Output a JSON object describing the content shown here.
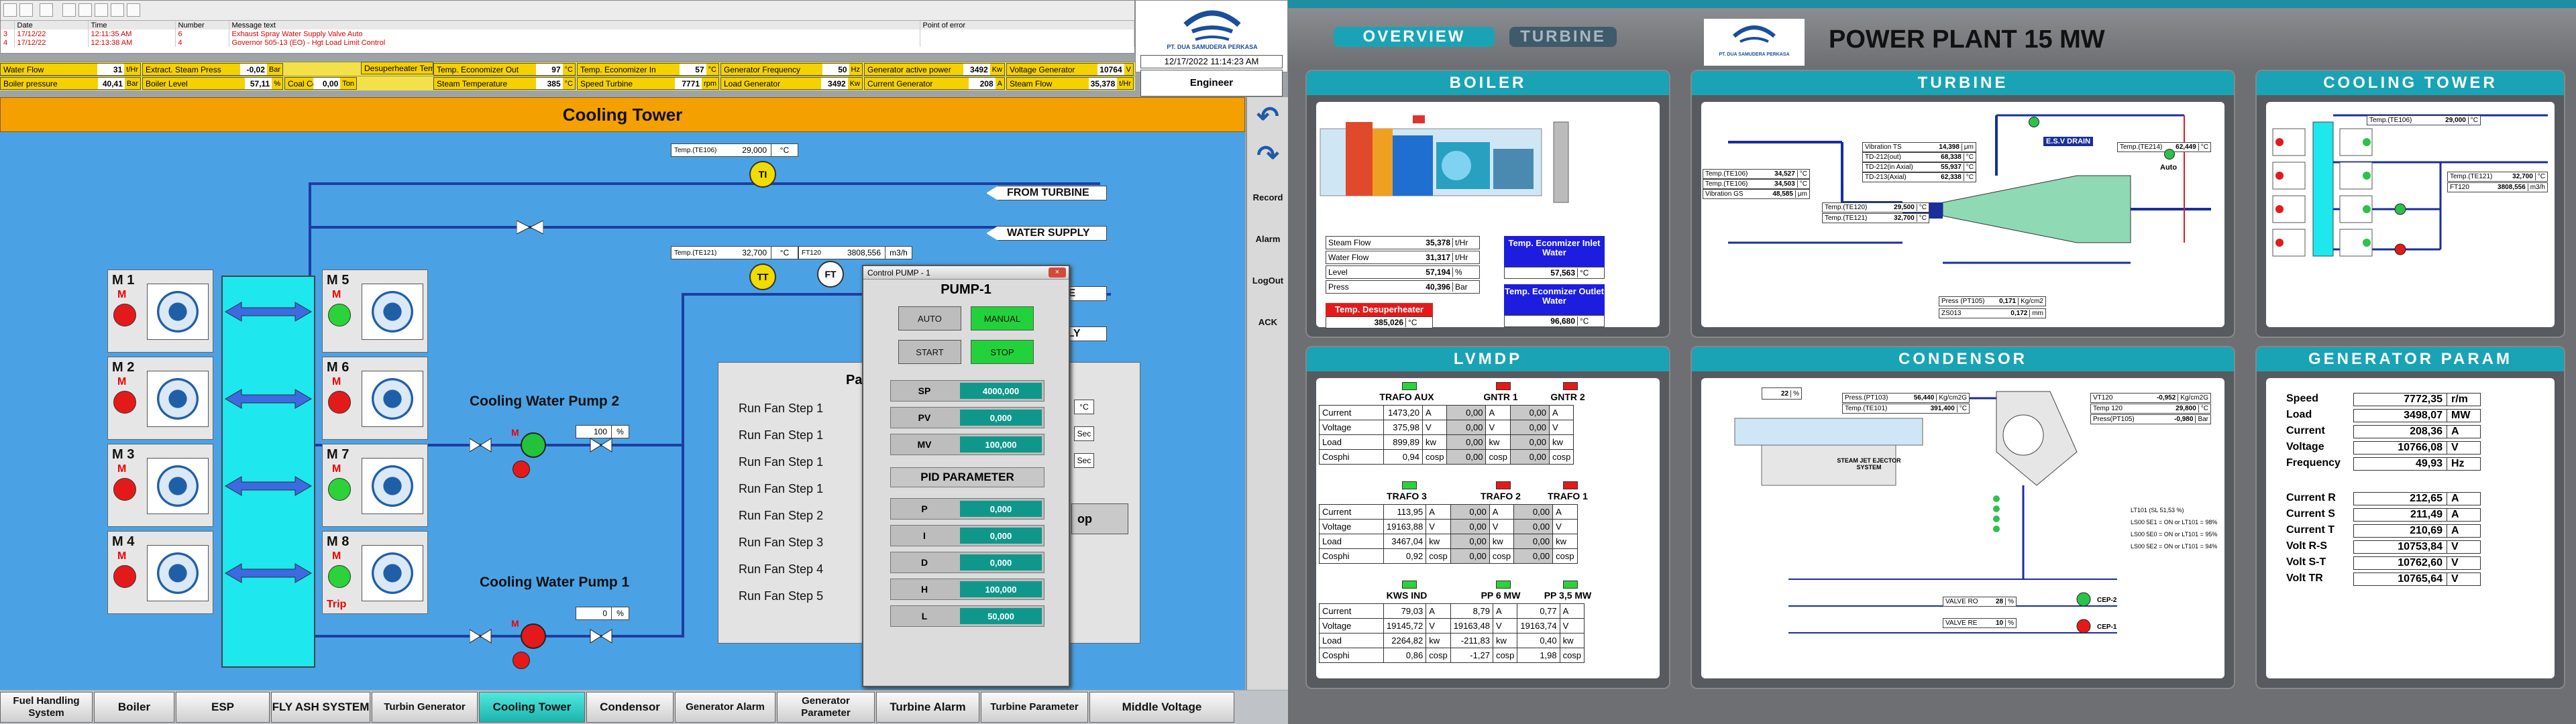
{
  "alarms": {
    "columns": [
      "Date",
      "Time",
      "Number",
      "Message text",
      "Point of error"
    ],
    "rows": [
      {
        "date": "17/12/22",
        "time": "12:11:35 AM",
        "number": "6",
        "message": "Exhaust Spray Water Supply Valve Auto",
        "point": ""
      },
      {
        "date": "17/12/22",
        "time": "12:13:38 AM",
        "number": "4",
        "message": "Governor 505-13 (EO) - Hgt Load Limit Control",
        "point": ""
      }
    ]
  },
  "status_rows": [
    [
      {
        "k": "Water Flow",
        "v": "31",
        "u": "t/Hr"
      },
      {
        "k": "Extract. Steam Press",
        "v": "-0,02",
        "u": "Bar"
      },
      {
        "k": "",
        "v": "",
        "u": ""
      },
      {
        "k": "Temp. Economizer Out",
        "v": "97",
        "u": "°C"
      },
      {
        "k": "Temp. Economizer In",
        "v": "57",
        "u": "°C"
      },
      {
        "k": "Generator Frequency",
        "v": "50",
        "u": "Hz"
      },
      {
        "k": "Generator active power",
        "v": "3492",
        "u": "Kw"
      },
      {
        "k": "Voltage Generator",
        "v": "10764",
        "u": "V"
      }
    ],
    [
      {
        "k": "Boiler pressure",
        "v": "40,41",
        "u": "Bar"
      },
      {
        "k": "Boiler Level",
        "v": "57,11",
        "u": "%"
      },
      {
        "k": "Coal Consumption",
        "v": "0,00",
        "u": "Ton"
      },
      {
        "k": "Steam Temperature",
        "v": "385",
        "u": "°C"
      },
      {
        "k": "Speed Turbine",
        "v": "7771",
        "u": "rpm"
      },
      {
        "k": "Load Generator",
        "v": "3492",
        "u": "Kw"
      },
      {
        "k": "Current Generator",
        "v": "208",
        "u": "A"
      },
      {
        "k": "Steam Flow",
        "v": "35,378",
        "u": "t/Hr"
      }
    ]
  ],
  "extra_status": {
    "desup_k": "Desuperheater Temp",
    "desup_v": "385",
    "desup_u": "°C"
  },
  "company": "PT. DUA SAMUDERA PERKASA",
  "datetime": "12/17/2022 11:14:23 AM",
  "user": "Engineer",
  "page_title": "Cooling Tower",
  "right_tools": [
    "Record",
    "Alarm",
    "LogOut",
    "ACK"
  ],
  "nav": [
    "Fuel Handling System",
    "Boiler",
    "ESP",
    "FLY ASH SYSTEM",
    "Turbin Generator",
    "Cooling Tower",
    "Condensor",
    "Generator Alarm",
    "Generator Parameter",
    "Turbine Alarm",
    "Turbine Parameter",
    "Middle Voltage"
  ],
  "motors": [
    {
      "name": "M 1",
      "state": "run"
    },
    {
      "name": "M 2",
      "state": "run"
    },
    {
      "name": "M 3",
      "state": "run"
    },
    {
      "name": "M 4",
      "state": "run"
    },
    {
      "name": "M 5",
      "state": "stop"
    },
    {
      "name": "M 6",
      "state": "run"
    },
    {
      "name": "M 7",
      "state": "stop"
    },
    {
      "name": "M 8",
      "state": "stop",
      "trip": "Trip"
    }
  ],
  "motor_m": "M",
  "sensors": {
    "te106_label": "Temp.(TE106)",
    "te106_v": "29,000",
    "te106_u": "°C",
    "te121_label": "Temp.(TE121)",
    "te121_v": "32,700",
    "te121_u": "°C",
    "ft_label": "FT120",
    "ft_v": "3808,556",
    "ft_u": "m3/h",
    "ti": "TI",
    "tt": "TT",
    "ft": "FT"
  },
  "flows": [
    "FROM TURBINE",
    "WATER SUPPLY",
    "NE",
    "PLY"
  ],
  "pumps": {
    "p2": "Cooling Water Pump 2",
    "p2_val": "100",
    "p2_u": "%",
    "p1": "Cooling Water Pump 1",
    "p1_val": "0",
    "p1_u": "%"
  },
  "run_steps": [
    "Run Fan Step 1",
    "Run Fan Step 1",
    "Run Fan Step 1",
    "Run Fan Step 1",
    "Run Fan Step 2",
    "Run Fan Step 3",
    "Run Fan Step 4",
    "Run Fan Step 5"
  ],
  "param_partial": "Pa",
  "param_units": [
    "°C",
    "Sec",
    "Sec"
  ],
  "stop_partial": "op",
  "dialog": {
    "title": "Control PUMP - 1",
    "close": "×",
    "head": "PUMP-1",
    "auto": "AUTO",
    "manual": "MANUAL",
    "start": "START",
    "stop": "STOP",
    "sp": {
      "k": "SP",
      "v": "4000,000"
    },
    "pv": {
      "k": "PV",
      "v": "0,000"
    },
    "mv": {
      "k": "MV",
      "v": "100,000"
    },
    "pid_head": "PID PARAMETER",
    "pid": [
      {
        "k": "P",
        "v": "0,000"
      },
      {
        "k": "I",
        "v": "0,000"
      },
      {
        "k": "D",
        "v": "0,000"
      },
      {
        "k": "H",
        "v": "100,000"
      },
      {
        "k": "L",
        "v": "50,000"
      }
    ]
  },
  "right": {
    "tabs": [
      "OVERVIEW",
      "TURBINE"
    ],
    "title": "POWER PLANT 15 MW",
    "company": "PT. DUA SAMUDERA PERKASA",
    "boiler": {
      "title": "BOILER",
      "rows": [
        {
          "k": "Steam Flow",
          "v": "35,378",
          "u": "t/Hr"
        },
        {
          "k": "Water Flow",
          "v": "31,317",
          "u": "t/Hr"
        },
        {
          "k": "Level",
          "v": "57,194",
          "u": "%"
        },
        {
          "k": "Press",
          "v": "40,396",
          "u": "Bar"
        }
      ],
      "eco_in": "Temp. Econmizer Inlet Water",
      "eco_in_v": "57,563",
      "eco_in_u": "°C",
      "eco_out": "Temp. Econmizer Outlet Water",
      "eco_out_v": "96,680",
      "eco_out_u": "°C",
      "desup": "Temp. Desuperheater",
      "desup_v": "385,026",
      "desup_u": "°C"
    },
    "turbine": {
      "title": "TURBINE",
      "vib": [
        {
          "k": "Vibration TS",
          "v": "14,398",
          "u": "μm"
        },
        {
          "k": "TD-212(out)",
          "v": "68,338",
          "u": "°C"
        },
        {
          "k": "TD-212(in Axial)",
          "v": "55,937",
          "u": "°C"
        },
        {
          "k": "TD-213(Axial)",
          "v": "62,338",
          "u": "°C"
        }
      ],
      "left": [
        {
          "k": "Temp.(TE106)",
          "v": "34,527",
          "u": "°C"
        },
        {
          "k": "Temp.(TE106)",
          "v": "34,503",
          "u": "°C"
        },
        {
          "k": "Vibration GS",
          "v": "48,585",
          "u": "μm"
        }
      ],
      "mid": [
        {
          "k": "Temp.(TE120)",
          "v": "29,500",
          "u": "°C"
        },
        {
          "k": "Temp.(TE121)",
          "v": "32,700",
          "u": "°C"
        }
      ],
      "te214": {
        "k": "Temp.(TE214)",
        "v": "62,449",
        "u": "°C"
      },
      "press": {
        "k": "Press (PT105)",
        "v": "0,171",
        "u": "Kg/cm2"
      },
      "zs": {
        "k": "ZS013",
        "v": "0,172",
        "u": "mm"
      },
      "esv": "E.S.V DRAIN",
      "auto": "Auto"
    },
    "cooling": {
      "title": "COOLING TOWER",
      "te106": {
        "k": "Temp.(TE106)",
        "v": "29,000",
        "u": "°C"
      },
      "te121": {
        "k": "Temp.(TE121)",
        "v": "32,700",
        "u": "°C"
      },
      "ft": {
        "k": "FT120",
        "v": "3808,556",
        "u": "m3/h"
      }
    },
    "lvmdp": {
      "title": "LVMDP",
      "groups": [
        {
          "heads": [
            "TRAFO AUX",
            "GNTR 1",
            "GNTR 2"
          ],
          "lamps": [
            "green",
            "red",
            "red"
          ],
          "rows": [
            [
              "Current",
              "1473,20",
              "A",
              "0,00",
              "A",
              "0,00",
              "A"
            ],
            [
              "Voltage",
              "375,98",
              "V",
              "0,00",
              "V",
              "0,00",
              "V"
            ],
            [
              "Load",
              "899,89",
              "kw",
              "0,00",
              "kw",
              "0,00",
              "kw"
            ],
            [
              "Cosphi",
              "0,94",
              "cosp",
              "0,00",
              "cosp",
              "0,00",
              "cosp"
            ]
          ]
        },
        {
          "heads": [
            "TRAFO 3",
            "TRAFO 2",
            "TRAFO 1"
          ],
          "lamps": [
            "green",
            "red",
            "red"
          ],
          "rows": [
            [
              "Current",
              "113,95",
              "A",
              "0,00",
              "A",
              "0,00",
              "A"
            ],
            [
              "Voltage",
              "19163,88",
              "V",
              "0,00",
              "V",
              "0,00",
              "V"
            ],
            [
              "Load",
              "3467,04",
              "kw",
              "0,00",
              "kw",
              "0,00",
              "kw"
            ],
            [
              "Cosphi",
              "0,92",
              "cosp",
              "0,00",
              "cosp",
              "0,00",
              "cosp"
            ]
          ]
        },
        {
          "heads": [
            "KWS IND",
            "PP 6 MW",
            "PP 3,5 MW"
          ],
          "lamps": [
            "green",
            "green",
            "green"
          ],
          "rows": [
            [
              "Current",
              "79,03",
              "A",
              "8,79",
              "A",
              "0,77",
              "A"
            ],
            [
              "Voltage",
              "19145,72",
              "V",
              "19163,48",
              "V",
              "19163,74",
              "V"
            ],
            [
              "Load",
              "2264,82",
              "kw",
              "-211,83",
              "kw",
              "0,40",
              "kw"
            ],
            [
              "Cosphi",
              "0,86",
              "cosp",
              "-1,27",
              "cosp",
              "1,98",
              "cosp"
            ]
          ]
        }
      ]
    },
    "condensor": {
      "title": "CONDENSOR",
      "pct": "22",
      "pct_u": "%",
      "press": {
        "k": "Press.(PT103)",
        "v": "56,440",
        "u": "Kg/cm2G"
      },
      "temp": {
        "k": "Temp.(TE101)",
        "v": "391,400",
        "u": "°C"
      },
      "vt": {
        "k": "VT120",
        "v": "-0,952",
        "u": "Kg/cm2G"
      },
      "t120": {
        "k": "Temp 120",
        "v": "29,800",
        "u": "°C"
      },
      "pt": {
        "k": "Press(PT105)",
        "v": "-0,980",
        "u": "Bar"
      },
      "ejector": "STEAM JET EJECTOR SYSTEM",
      "lamps": [
        "LT101 (SL 51,53 %)",
        "LS00 5E1 = ON or LT101 = 98%",
        "LS00 5E0 = ON or LT101 = 95%",
        "LS00 5E2 = ON or LT101 = 94%"
      ],
      "cep": [
        "CEP-2",
        "CEP-1"
      ],
      "valves": [
        {
          "k": "VALVE RO",
          "v": "28",
          "u": "%"
        },
        {
          "k": "VALVE RE",
          "v": "10",
          "u": "%"
        }
      ]
    },
    "generator": {
      "title": "GENERATOR PARAM",
      "rows1": [
        {
          "k": "Speed",
          "v": "7772,35",
          "u": "r/m"
        },
        {
          "k": "Load",
          "v": "3498,07",
          "u": "MW"
        },
        {
          "k": "Current",
          "v": "208,36",
          "u": "A"
        },
        {
          "k": "Voltage",
          "v": "10766,08",
          "u": "V"
        },
        {
          "k": "Frequency",
          "v": "49,93",
          "u": "Hz"
        }
      ],
      "rows2": [
        {
          "k": "Current R",
          "v": "212,65",
          "u": "A"
        },
        {
          "k": "Current S",
          "v": "211,49",
          "u": "A"
        },
        {
          "k": "Current T",
          "v": "210,69",
          "u": "A"
        },
        {
          "k": "Volt R-S",
          "v": "10753,84",
          "u": "V"
        },
        {
          "k": "Volt S-T",
          "v": "10762,60",
          "u": "V"
        },
        {
          "k": "Volt TR",
          "v": "10765,64",
          "u": "V"
        }
      ]
    }
  }
}
